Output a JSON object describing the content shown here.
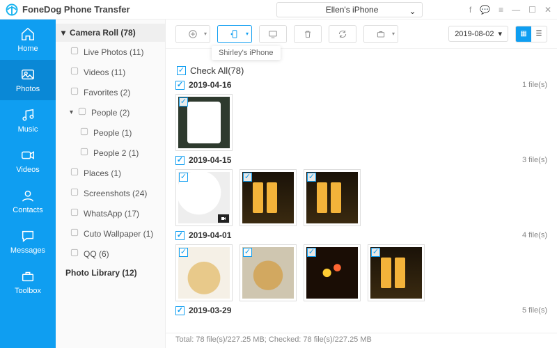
{
  "app_title": "FoneDog Phone Transfer",
  "device": {
    "name": "Ellen's iPhone"
  },
  "tooltip_target": "Shirley's iPhone",
  "date_filter": "2019-08-02",
  "nav": [
    {
      "id": "home",
      "label": "Home"
    },
    {
      "id": "photos",
      "label": "Photos"
    },
    {
      "id": "music",
      "label": "Music"
    },
    {
      "id": "videos",
      "label": "Videos"
    },
    {
      "id": "contacts",
      "label": "Contacts"
    },
    {
      "id": "messages",
      "label": "Messages"
    },
    {
      "id": "toolbox",
      "label": "Toolbox"
    }
  ],
  "nav_active": "photos",
  "sidebar": {
    "header": "Camera Roll (78)",
    "items": [
      {
        "label": "Live Photos (11)",
        "icon": "sparkle"
      },
      {
        "label": "Videos (11)",
        "icon": "video"
      },
      {
        "label": "Favorites (2)",
        "icon": "heart"
      },
      {
        "label": "People (2)",
        "icon": "people",
        "expandable": true,
        "children": [
          {
            "label": "People (1)"
          },
          {
            "label": "People 2 (1)"
          }
        ]
      },
      {
        "label": "Places (1)",
        "icon": "pin"
      },
      {
        "label": "Screenshots (24)",
        "icon": "screenshot"
      },
      {
        "label": "WhatsApp (17)",
        "icon": "whatsapp"
      },
      {
        "label": "Cuto Wallpaper (1)",
        "icon": "image"
      },
      {
        "label": "QQ (6)",
        "icon": "qq"
      }
    ],
    "footer": "Photo Library (12)"
  },
  "check_all_label": "Check All(78)",
  "groups": [
    {
      "date": "2019-04-16",
      "count_label": "1 file(s)",
      "thumbs": [
        {
          "kind": "phone"
        }
      ]
    },
    {
      "date": "2019-04-15",
      "count_label": "3 file(s)",
      "thumbs": [
        {
          "kind": "cup",
          "video": true
        },
        {
          "kind": "beer"
        },
        {
          "kind": "beer"
        }
      ]
    },
    {
      "date": "2019-04-01",
      "count_label": "4 file(s)",
      "thumbs": [
        {
          "kind": "dog1"
        },
        {
          "kind": "dog2"
        },
        {
          "kind": "lights"
        },
        {
          "kind": "beer"
        }
      ]
    },
    {
      "date": "2019-03-29",
      "count_label": "5 file(s)",
      "thumbs": []
    }
  ],
  "status": "Total: 78 file(s)/227.25 MB; Checked: 78 file(s)/227.25 MB"
}
